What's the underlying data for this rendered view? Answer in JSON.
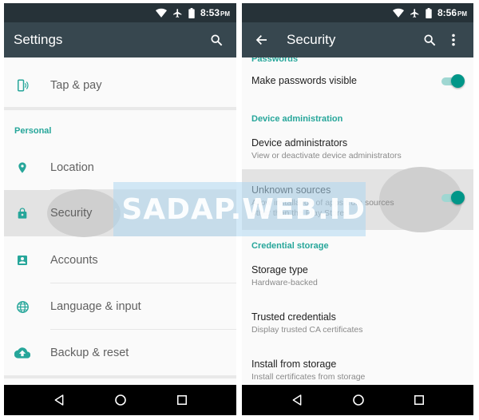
{
  "left": {
    "status": {
      "time": "8:53",
      "ampm": "PM"
    },
    "appbar": {
      "title": "Settings",
      "search_icon": "search-icon"
    },
    "rows_top": [
      {
        "label": "Tap & pay",
        "icon": "tap-pay-icon"
      }
    ],
    "section": "Personal",
    "rows": [
      {
        "label": "Location",
        "icon": "location-icon"
      },
      {
        "label": "Security",
        "icon": "lock-icon"
      },
      {
        "label": "Accounts",
        "icon": "account-icon"
      },
      {
        "label": "Language & input",
        "icon": "globe-icon"
      },
      {
        "label": "Backup & reset",
        "icon": "cloud-upload-icon"
      }
    ]
  },
  "right": {
    "status": {
      "time": "8:56",
      "ampm": "PM"
    },
    "appbar": {
      "title": "Security",
      "back_icon": "back-arrow-icon",
      "search_icon": "search-icon",
      "menu_icon": "overflow-menu-icon"
    },
    "section_passwords": "Passwords",
    "make_passwords_visible": {
      "title": "Make passwords visible",
      "checked": true
    },
    "section_device_admin": "Device administration",
    "device_administrators": {
      "title": "Device administrators",
      "summary": "View or deactivate device administrators"
    },
    "unknown_sources": {
      "title": "Unknown sources",
      "summary_line1": "Allow installation of apps from sources",
      "summary_line2": "other than the Play Store",
      "checked": true
    },
    "section_credential": "Credential storage",
    "storage_type": {
      "title": "Storage type",
      "summary": "Hardware-backed"
    },
    "trusted_credentials": {
      "title": "Trusted credentials",
      "summary": "Display trusted CA certificates"
    },
    "install_from_storage": {
      "title": "Install from storage",
      "summary": "Install certificates from storage"
    }
  },
  "navbar": {
    "back_icon": "nav-back-icon",
    "home_icon": "nav-home-icon",
    "recents_icon": "nav-recents-icon"
  },
  "watermark": {
    "text": "SADAP.WEB.ID"
  },
  "colors": {
    "statusbar": "#263238",
    "appbar": "#37474f",
    "accent": "#26a69a",
    "toggle": "#009688"
  }
}
